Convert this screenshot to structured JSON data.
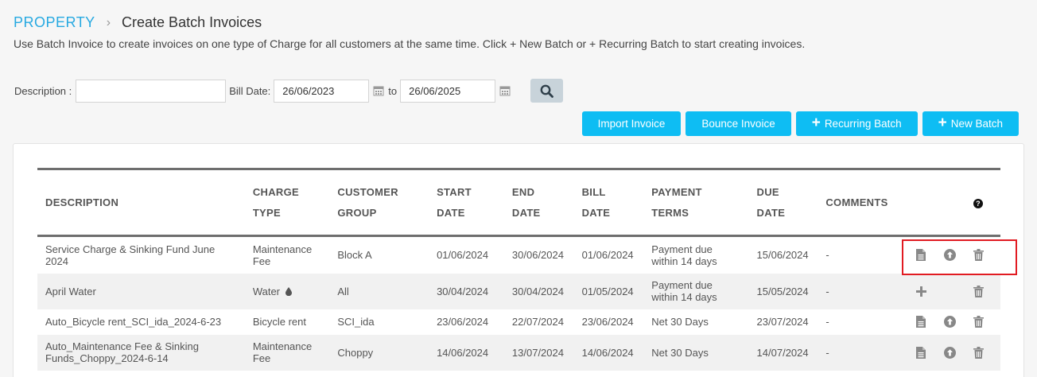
{
  "breadcrumb": {
    "root": "PROPERTY",
    "separator": "›",
    "current": "Create Batch Invoices"
  },
  "intro": "Use Batch Invoice to create invoices on one type of Charge for all customers at the same time. Click + New Batch or + Recurring Batch to start creating invoices.",
  "filters": {
    "description_label": "Description :",
    "description_value": "",
    "bill_date_label": "Bill Date:",
    "from_value": "26/06/2023",
    "to_label": "to",
    "to_value": "26/06/2025"
  },
  "buttons": {
    "import_invoice": "Import Invoice",
    "bounce_invoice": "Bounce Invoice",
    "recurring_batch": "Recurring Batch",
    "new_batch": "New Batch"
  },
  "table": {
    "headers": {
      "description": "DESCRIPTION",
      "charge_type_1": "CHARGE",
      "charge_type_2": "TYPE",
      "customer_group_1": "CUSTOMER",
      "customer_group_2": "GROUP",
      "start_date_1": "START",
      "start_date_2": "DATE",
      "end_date_1": "END",
      "end_date_2": "DATE",
      "bill_date_1": "BILL",
      "bill_date_2": "DATE",
      "payment_terms": "PAYMENT TERMS",
      "due_date_1": "DUE",
      "due_date_2": "DATE",
      "comments": "COMMENTS",
      "help": "?"
    },
    "rows": [
      {
        "description": "Service Charge & Sinking Fund June 2024",
        "charge_type": "Maintenance Fee",
        "customer_group": "Block A",
        "start_date": "01/06/2024",
        "end_date": "30/06/2024",
        "bill_date": "01/06/2024",
        "payment_terms": "Payment due within 14 days",
        "due_date": "15/06/2024",
        "comments": "-"
      },
      {
        "description": "April Water",
        "charge_type": "Water",
        "customer_group": "All",
        "start_date": "30/04/2024",
        "end_date": "30/04/2024",
        "bill_date": "01/05/2024",
        "payment_terms": "Payment due within 14 days",
        "due_date": "15/05/2024",
        "comments": "-"
      },
      {
        "description": "Auto_Bicycle rent_SCI_ida_2024-6-23",
        "charge_type": "Bicycle rent",
        "customer_group": "SCI_ida",
        "start_date": "23/06/2024",
        "end_date": "22/07/2024",
        "bill_date": "23/06/2024",
        "payment_terms": "Net 30 Days",
        "due_date": "23/07/2024",
        "comments": "-"
      },
      {
        "description": "Auto_Maintenance Fee & Sinking Funds_Choppy_2024-6-14",
        "charge_type": "Maintenance Fee",
        "customer_group": "Choppy",
        "start_date": "14/06/2024",
        "end_date": "13/07/2024",
        "bill_date": "14/06/2024",
        "payment_terms": "Net 30 Days",
        "due_date": "14/07/2024",
        "comments": "-"
      }
    ]
  },
  "colors": {
    "accent": "#0ebdf3",
    "breadcrumb": "#27a9e1",
    "highlight": "#e11b22"
  },
  "icons": [
    "calendar-icon",
    "search-icon",
    "plus-icon",
    "document-icon",
    "upload-icon",
    "trash-icon",
    "help-icon",
    "water-drop-icon"
  ]
}
